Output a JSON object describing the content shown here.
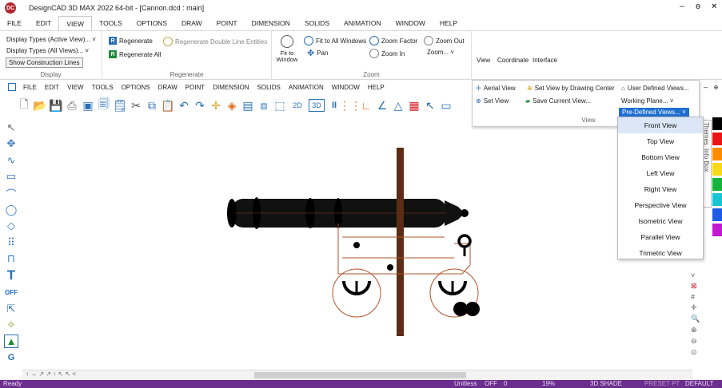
{
  "window": {
    "title": "DesignCAD 3D MAX 2022 64-bit - [Cannon.dcd : main]",
    "logo_text": "DC",
    "minimize": "–",
    "restore": "ɵ",
    "close": "×"
  },
  "menubar": {
    "items": [
      "FILE",
      "EDIT",
      "VIEW",
      "TOOLS",
      "OPTIONS",
      "DRAW",
      "POINT",
      "DIMENSION",
      "SOLIDS",
      "ANIMATION",
      "WINDOW",
      "HELP"
    ],
    "active": "VIEW"
  },
  "ribbon": {
    "display": {
      "label": "Display",
      "items": [
        "Display Types (Active View)... ˅",
        "Display Types (All Views)... ˅",
        "Show Construction Lines"
      ]
    },
    "regenerate": {
      "label": "Regenerate",
      "regenerate": "Regenerate",
      "regenerate_double": "Regenerate Double Line Entities",
      "regenerate_all": "Regenerate All"
    },
    "zoom": {
      "label": "Zoom",
      "fit_to_window": "Fit to Window",
      "fit_all": "Fit to All Windows",
      "pan": "Pan",
      "zoom_factor": "Zoom Factor",
      "zoom_in": "Zoom In",
      "zoom_out": "Zoom Out",
      "zoom_menu": "Zoom... ˅"
    },
    "tabs": {
      "view": "View",
      "coordinate": "Coordinate",
      "interface": "Interface"
    }
  },
  "inner_menubar": [
    "FILE",
    "EDIT",
    "VIEW",
    "TOOLS",
    "OPTIONS",
    "DRAW",
    "POINT",
    "DIMENSION",
    "SOLIDS",
    "ANIMATION",
    "WINDOW",
    "HELP"
  ],
  "toolbar_labels": {
    "btn_2d": "2D",
    "btn_3d": "3D",
    "pause": "II"
  },
  "view_panel": {
    "aerial_view": "Aerial View",
    "set_view_center": "Set View by Drawing Center",
    "user_defined": "User Defined Views...",
    "set_view": "Set View",
    "save_current": "Save Current View...",
    "working_plane": "Working Plane... ˅",
    "predefined": "Pre-Defined Views... ˅",
    "group_label": "View"
  },
  "predefined_views": [
    "Front View",
    "Top View",
    "Bottom View",
    "Left View",
    "Right View",
    "Perspective View",
    "Isometric View",
    "Parallel View",
    "Trimetric View"
  ],
  "side_tabs": {
    "themes": "Themes",
    "info_box": "Info Box"
  },
  "left_tools": {
    "off": "OFF",
    "text_tool": "T",
    "g_tool": "G"
  },
  "palette_colors": [
    "#000000",
    "#e81416",
    "#ff8c00",
    "#f7d917",
    "#16b43a",
    "#17c4d2",
    "#1e5be6",
    "#c21ad0"
  ],
  "status": {
    "ready": "Ready",
    "units": "Unitless",
    "snap": "OFF",
    "layer": "0",
    "zoom": "19%",
    "shade": "3D SHADE",
    "preset": "PRESET PT",
    "default": "DEFAULT WP"
  },
  "bottom_scroll_arrows": "↑ → ↗ ↗ ↑ ↖ ↖ <"
}
